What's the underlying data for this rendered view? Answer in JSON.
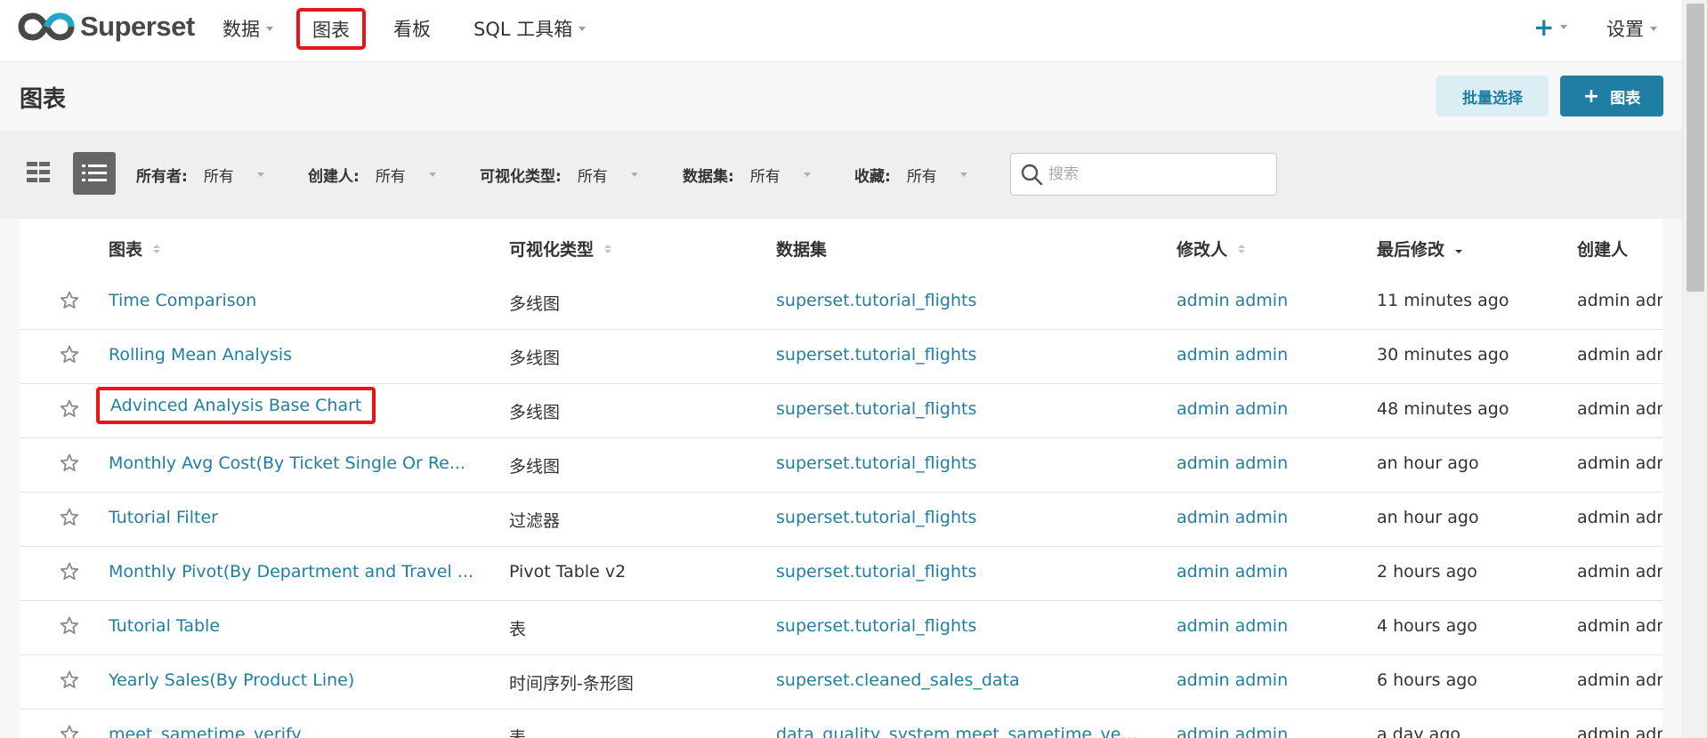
{
  "app": {
    "brand": "Superset",
    "accent_color": "#1f7ea1",
    "highlight_color": "#e8131b"
  },
  "nav": {
    "data_label": "数据",
    "charts_label": "图表",
    "dashboards_label": "看板",
    "sql_label": "SQL 工具箱",
    "plus_label": "+",
    "settings_label": "设置"
  },
  "header": {
    "title": "图表",
    "bulk_select_label": "批量选择",
    "add_chart_plus": "+",
    "add_chart_label": "图表"
  },
  "filters": {
    "owner": {
      "label": "所有者:",
      "value": "所有"
    },
    "creator": {
      "label": "创建人:",
      "value": "所有"
    },
    "viz_type": {
      "label": "可视化类型:",
      "value": "所有"
    },
    "dataset": {
      "label": "数据集:",
      "value": "所有"
    },
    "favorite": {
      "label": "收藏:",
      "value": "所有"
    },
    "search_placeholder": "搜索"
  },
  "table": {
    "columns": [
      "图表",
      "可视化类型",
      "数据集",
      "修改人",
      "最后修改",
      "创建人"
    ],
    "rows": [
      {
        "name": "Time Comparison",
        "viz": "多线图",
        "dataset": "superset.tutorial_flights",
        "modified_by": "admin admin",
        "last_modified": "11 minutes ago",
        "created_by": "admin admin"
      },
      {
        "name": "Rolling Mean Analysis",
        "viz": "多线图",
        "dataset": "superset.tutorial_flights",
        "modified_by": "admin admin",
        "last_modified": "30 minutes ago",
        "created_by": "admin admin"
      },
      {
        "name": "Advinced Analysis Base Chart",
        "viz": "多线图",
        "dataset": "superset.tutorial_flights",
        "modified_by": "admin admin",
        "last_modified": "48 minutes ago",
        "created_by": "admin admin"
      },
      {
        "name": "Monthly Avg Cost(By Ticket Single Or Re...",
        "viz": "多线图",
        "dataset": "superset.tutorial_flights",
        "modified_by": "admin admin",
        "last_modified": "an hour ago",
        "created_by": "admin admin"
      },
      {
        "name": "Tutorial Filter",
        "viz": "过滤器",
        "dataset": "superset.tutorial_flights",
        "modified_by": "admin admin",
        "last_modified": "an hour ago",
        "created_by": "admin admin"
      },
      {
        "name": "Monthly Pivot(By Department and Travel ...",
        "viz": "Pivot Table v2",
        "dataset": "superset.tutorial_flights",
        "modified_by": "admin admin",
        "last_modified": "2 hours ago",
        "created_by": "admin admin"
      },
      {
        "name": "Tutorial Table",
        "viz": "表",
        "dataset": "superset.tutorial_flights",
        "modified_by": "admin admin",
        "last_modified": "4 hours ago",
        "created_by": "admin admin"
      },
      {
        "name": "Yearly Sales(By Product Line)",
        "viz": "时间序列-条形图",
        "dataset": "superset.cleaned_sales_data",
        "modified_by": "admin admin",
        "last_modified": "6 hours ago",
        "created_by": "admin admin"
      },
      {
        "name": "meet_sametime_verify",
        "viz": "表",
        "dataset": "data_quality_system.meet_sametime_verify",
        "modified_by": "admin admin",
        "last_modified": "a day ago",
        "created_by": "admin admin"
      }
    ]
  }
}
